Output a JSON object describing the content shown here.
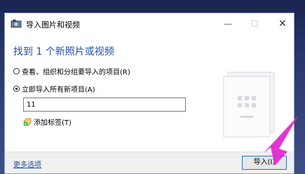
{
  "window": {
    "title": "导入图片和视频",
    "minimize_label": "—",
    "maximize_label": "☐",
    "close_label": "✕"
  },
  "heading": "找到 1 个新照片或视频",
  "options": [
    {
      "label": "查看、组织和分组要导入的项目(R)",
      "selected": false
    },
    {
      "label": "立即导入所有新项目(A)",
      "selected": true
    }
  ],
  "folder_name_input": {
    "value": "11"
  },
  "add_tags_label": "添加标签(T)",
  "footer": {
    "more_options_label": "更多选项",
    "import_label": "导入(I)"
  },
  "colors": {
    "accent": "#1e4fa8",
    "annotation_arrow": "#e020d0"
  }
}
